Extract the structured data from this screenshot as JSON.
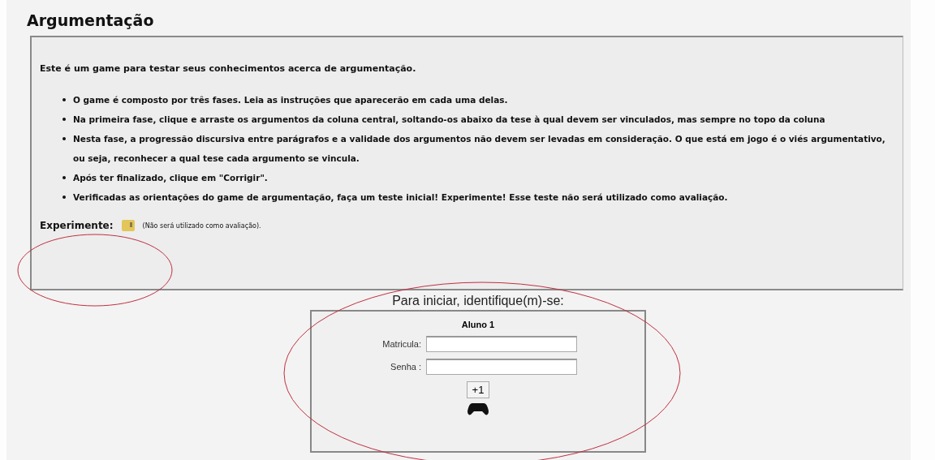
{
  "title": "Argumentação",
  "intro": {
    "text": "Este é um game para testar seus conhecimentos acerca de argumentação.",
    "bullets": [
      "O game é composto por três fases. Leia as instruções que aparecerão em cada uma delas.",
      "Na primeira fase, clique e arraste os argumentos da coluna central, soltando-os abaixo da tese à qual devem ser vinculados, mas sempre no topo da coluna",
      "Nesta fase, a progressão discursiva entre parágrafos e a validade dos argumentos não devem ser levadas em consideração. O que está em jogo é o viés argumentativo, ou seja, reconhecer a qual tese cada argumento se vincula.",
      "Após ter finalizado, clique em \"Corrigir\".",
      "Verificadas as orientações do game de argumentação, faça um teste inicial! Experimente! Esse teste não será utilizado como avaliação."
    ],
    "try_label": "Experimente:",
    "try_note": "(Não será utilizado como avaliação)."
  },
  "login": {
    "heading": "Para iniciar, identifique(m)-se:",
    "student": "Aluno 1",
    "fields": [
      {
        "label": "Matricula:"
      },
      {
        "label": "Senha :"
      }
    ],
    "add_button": "+1"
  }
}
